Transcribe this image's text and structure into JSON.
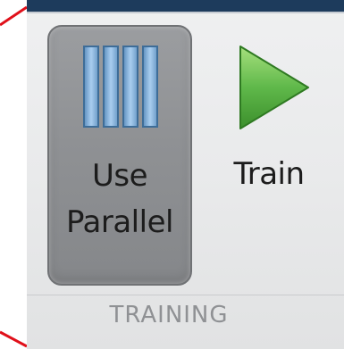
{
  "toolstrip": {
    "buttons": [
      {
        "id": "use-parallel",
        "label_line1": "Use",
        "label_line2": "Parallel",
        "icon": "parallel-bars-icon",
        "state": "pressed"
      },
      {
        "id": "train",
        "label_line1": "Train",
        "icon": "play-triangle-icon",
        "state": "normal"
      }
    ],
    "group_label": "TRAINING"
  },
  "colors": {
    "header_bar": "#1d3b5c",
    "panel_background": "#e9eaeb",
    "pressed_button": "#8f9194",
    "parallel_bar_fill": "#8ab6dd",
    "parallel_bar_stroke": "#3e6d98",
    "train_triangle_fill": "#5fb84a",
    "group_label_text": "#8f9194",
    "callout_line": "#e0101a"
  }
}
